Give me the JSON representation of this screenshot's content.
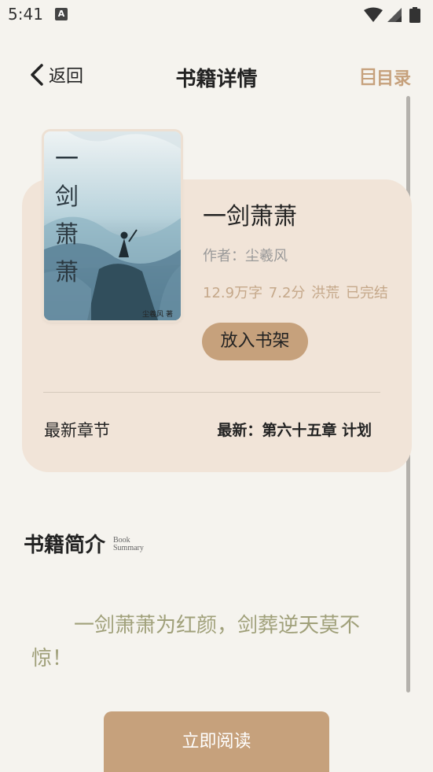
{
  "status": {
    "time": "5:41",
    "notification_glyph": "A"
  },
  "header": {
    "back_label": "返回",
    "title": "书籍详情",
    "toc_label": "目录"
  },
  "book": {
    "title": "一剑萧萧",
    "author": "作者：尘羲风",
    "meta": "12.9万字  7.2分  洪荒  已完结",
    "shelf_button": "放入书架",
    "cover_title": "一剑萧萧",
    "cover_author": "尘羲风 著"
  },
  "latest": {
    "label": "最新章节",
    "value": "最新：第六十五章 计划"
  },
  "summary": {
    "heading": "书籍简介",
    "heading_en_line1": "Book",
    "heading_en_line2": "Summary",
    "text": "一剑萧萧为红颜，剑葬逆天莫不惊！"
  },
  "footer": {
    "read_button": "立即阅读"
  },
  "colors": {
    "accent": "#c6a17c",
    "card_bg": "#f1e4d8",
    "page_bg": "#f5f3ee",
    "summary_text": "#a0a07a"
  }
}
